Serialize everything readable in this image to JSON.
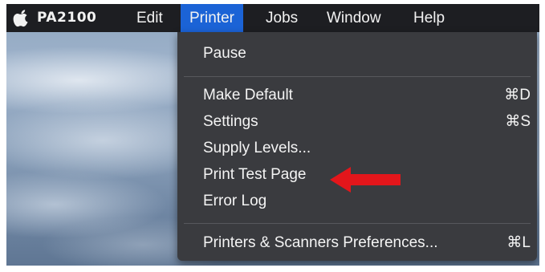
{
  "menubar": {
    "app_name": "PA2100",
    "menus": [
      "Edit",
      "Printer",
      "Jobs",
      "Window",
      "Help"
    ],
    "active_menu": "Printer"
  },
  "dropdown": {
    "items": [
      {
        "label": "Pause",
        "shortcut": ""
      },
      {
        "label": "Make Default",
        "shortcut": "⌘D"
      },
      {
        "label": "Settings",
        "shortcut": "⌘S"
      },
      {
        "label": "Supply Levels...",
        "shortcut": ""
      },
      {
        "label": "Print Test Page",
        "shortcut": ""
      },
      {
        "label": "Error Log",
        "shortcut": ""
      },
      {
        "label": "Printers & Scanners Preferences...",
        "shortcut": "⌘L"
      }
    ]
  },
  "annotation": {
    "icon": "red-arrow-icon",
    "color": "#e3161b"
  },
  "colors": {
    "menubar": "#1d1e22",
    "menu_bg": "#3a3b3f",
    "highlight": "#1b63d6"
  }
}
